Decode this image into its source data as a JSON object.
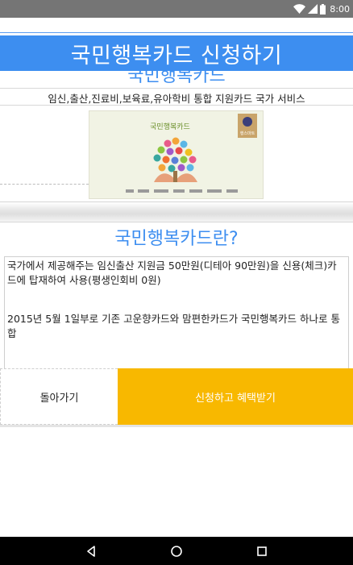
{
  "status_bar": {
    "time": "8:00",
    "icons": [
      "wifi-icon",
      "cellular-icon",
      "battery-icon"
    ]
  },
  "header": {
    "title": "국민행복카드 신청하기",
    "subtitle": "국민행복카드",
    "tagline": "임신,출산,진료비,보육료,유아학비 통합 지원카드 국가 서비스"
  },
  "banner": {
    "logo_text": "국민행복카드",
    "badge_text": "행스마트"
  },
  "section": {
    "title": "국민행복카드란?",
    "paragraphs": [
      "국가에서 제공해주는 임신출산 지원금 50만원(디테아 90만원)을 신용(체크)카드에 탑재하여 사용(평생인회비 0원)",
      "2015년 5월 1일부로 기존 고운향카드와 맘편한카드가 국민행복카드 하나로 통합"
    ]
  },
  "buttons": {
    "back": "돌아가기",
    "apply": "신청하고 혜택받기"
  },
  "colors": {
    "status_bar": "#757575",
    "title_bar": "#3d8ef0",
    "accent_text": "#3d8ef0",
    "apply_button": "#f8b800",
    "nav_bar": "#000000"
  },
  "nav": {
    "icons": [
      "back-icon",
      "home-icon",
      "recents-icon"
    ]
  }
}
